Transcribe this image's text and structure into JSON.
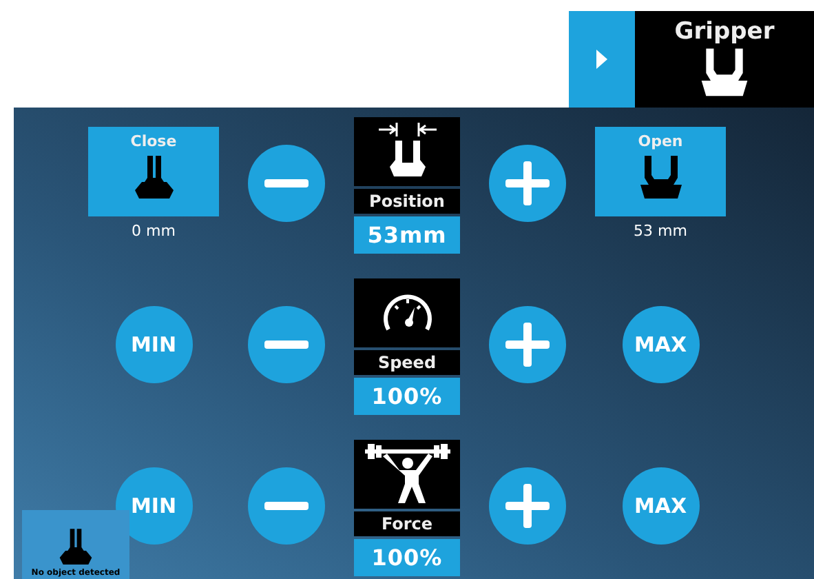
{
  "header": {
    "title": "Gripper"
  },
  "controls": [
    {
      "kind": "position",
      "left": {
        "kind": "preset",
        "label": "Close",
        "reading": "0 mm"
      },
      "right": {
        "kind": "preset",
        "label": "Open",
        "reading": "53 mm"
      },
      "label": "Position",
      "value": "53mm"
    },
    {
      "kind": "speed",
      "left": {
        "kind": "limit",
        "label": "MIN"
      },
      "right": {
        "kind": "limit",
        "label": "MAX"
      },
      "label": "Speed",
      "value": "100%"
    },
    {
      "kind": "force",
      "left": {
        "kind": "limit",
        "label": "MIN"
      },
      "right": {
        "kind": "limit",
        "label": "MAX"
      },
      "label": "Force",
      "value": "100%"
    }
  ],
  "status": {
    "text": "No object detected"
  }
}
